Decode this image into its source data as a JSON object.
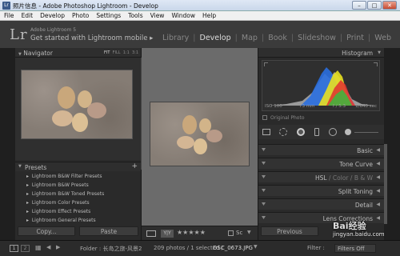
{
  "window": {
    "title": "照片信息 - Adobe Photoshop Lightroom - Develop",
    "controls": {
      "minimize": "–",
      "maximize": "□",
      "close": "✕"
    }
  },
  "menu": [
    "File",
    "Edit",
    "Develop",
    "Photo",
    "Settings",
    "Tools",
    "View",
    "Window",
    "Help"
  ],
  "identity": {
    "logo": "Lr",
    "version": "Adobe Lightroom 5",
    "message": "Get started with Lightroom mobile ▸"
  },
  "modules": {
    "items": [
      "Library",
      "Develop",
      "Map",
      "Book",
      "Slideshow",
      "Print",
      "Web"
    ],
    "active": "Develop"
  },
  "navigator": {
    "title": "Navigator",
    "zoom": [
      "FIT",
      "FILL",
      "1:1",
      "3:1"
    ]
  },
  "presets": {
    "title": "Presets",
    "add": "+",
    "items": [
      "Lightroom B&W Filter Presets",
      "Lightroom B&W Presets",
      "Lightroom B&W Toned Presets",
      "Lightroom Color Presets",
      "Lightroom Effect Presets",
      "Lightroom General Presets"
    ]
  },
  "left_buttons": {
    "copy": "Copy...",
    "paste": "Paste"
  },
  "toolbar": {
    "stars": "★★★★★",
    "soft_proof": "Sc"
  },
  "histogram": {
    "title": "Histogram",
    "iso": "ISO 100",
    "focal": "73 mm",
    "aperture": "f / 5.3",
    "shutter": "1/640 sec",
    "original": "Original Photo"
  },
  "panels": {
    "basic": "Basic",
    "tone_curve": "Tone Curve",
    "hsl": "HSL",
    "hsl_sep1": "/",
    "color": "Color",
    "hsl_sep2": "/",
    "bw": "B & W",
    "split_toning": "Split Toning",
    "detail": "Detail",
    "lens": "Lens Corrections"
  },
  "right_buttons": {
    "previous": "Previous"
  },
  "filmstrip": {
    "view1": "1",
    "view2": "2",
    "folder": "Folder : 长岛之旅-风景2",
    "count": "209 photos / 1 selected /",
    "file": "DSC_0673.JPG",
    "filter_label": "Filter :",
    "filter_value": "Filters Off"
  },
  "watermark": {
    "text": "jingyan.baidu.com",
    "brand": "Bai经验"
  }
}
